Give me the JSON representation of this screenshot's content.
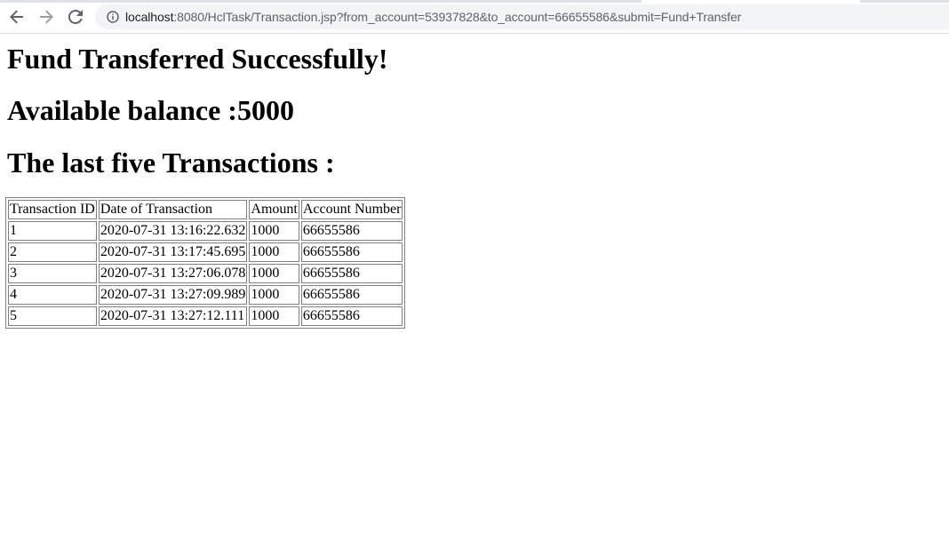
{
  "browser": {
    "url_host": "localhost",
    "url_rest": ":8080/HclTask/Transaction.jsp?from_account=53937828&to_account=66655586&submit=Fund+Transfer"
  },
  "page": {
    "heading_success": "Fund Transferred Successfully!",
    "heading_balance": "Available balance :5000",
    "heading_transactions": "The last five Transactions :"
  },
  "table": {
    "headers": [
      "Transaction ID",
      "Date of Transaction",
      "Amount",
      "Account Number"
    ],
    "rows": [
      [
        "1",
        "2020-07-31 13:16:22.632",
        "1000",
        "66655586"
      ],
      [
        "2",
        "2020-07-31 13:17:45.695",
        "1000",
        "66655586"
      ],
      [
        "3",
        "2020-07-31 13:27:06.078",
        "1000",
        "66655586"
      ],
      [
        "4",
        "2020-07-31 13:27:09.989",
        "1000",
        "66655586"
      ],
      [
        "5",
        "2020-07-31 13:27:12.111",
        "1000",
        "66655586"
      ]
    ]
  },
  "colors": {
    "toolbar_bg": "#ffffff",
    "omnibox_bg": "#f1f3f4",
    "icon": "#5f6368",
    "table_border": "#808080"
  },
  "icons": [
    "back-arrow-icon",
    "forward-arrow-icon",
    "reload-icon",
    "info-icon"
  ]
}
